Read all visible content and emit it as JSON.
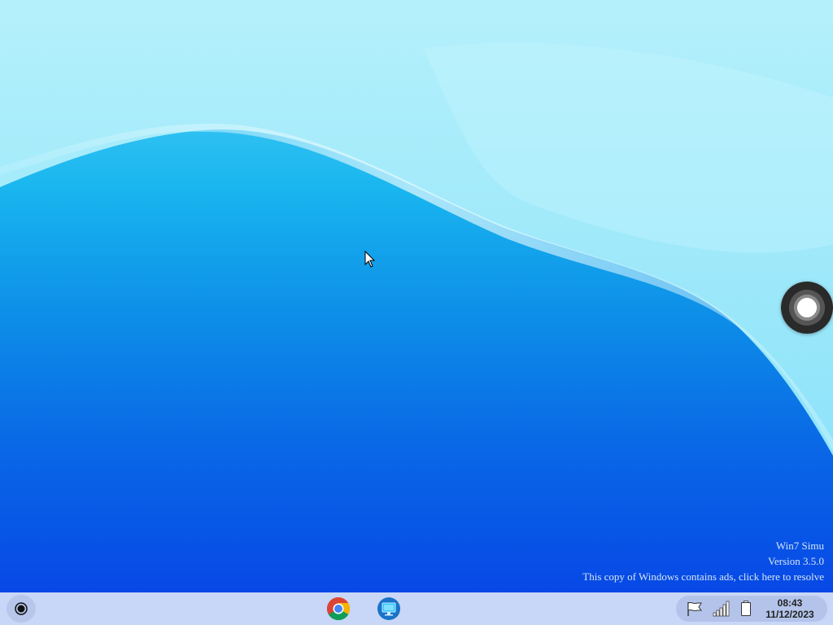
{
  "desktop": {
    "watermark": {
      "product": "Win7 Simu",
      "version": "Version 3.5.0",
      "notice": "This copy of Windows contains ads, click here to resolve"
    }
  },
  "taskbar": {
    "start_icon": "start-orb-icon",
    "pinned_apps": [
      {
        "name": "Google Chrome",
        "icon": "chrome-icon"
      },
      {
        "name": "Remote desktop",
        "icon": "monitor-icon"
      }
    ],
    "tray": {
      "icons": [
        "flag-icon",
        "signal-bars-icon",
        "battery-icon"
      ],
      "time": "08:43",
      "date": "11/12/2023"
    }
  },
  "colors": {
    "taskbar_bg": "#c8d6f7",
    "tray_bg": "#b3c3ea",
    "wallpaper_top": "#5fd6f7",
    "wallpaper_bottom": "#0748e6"
  }
}
